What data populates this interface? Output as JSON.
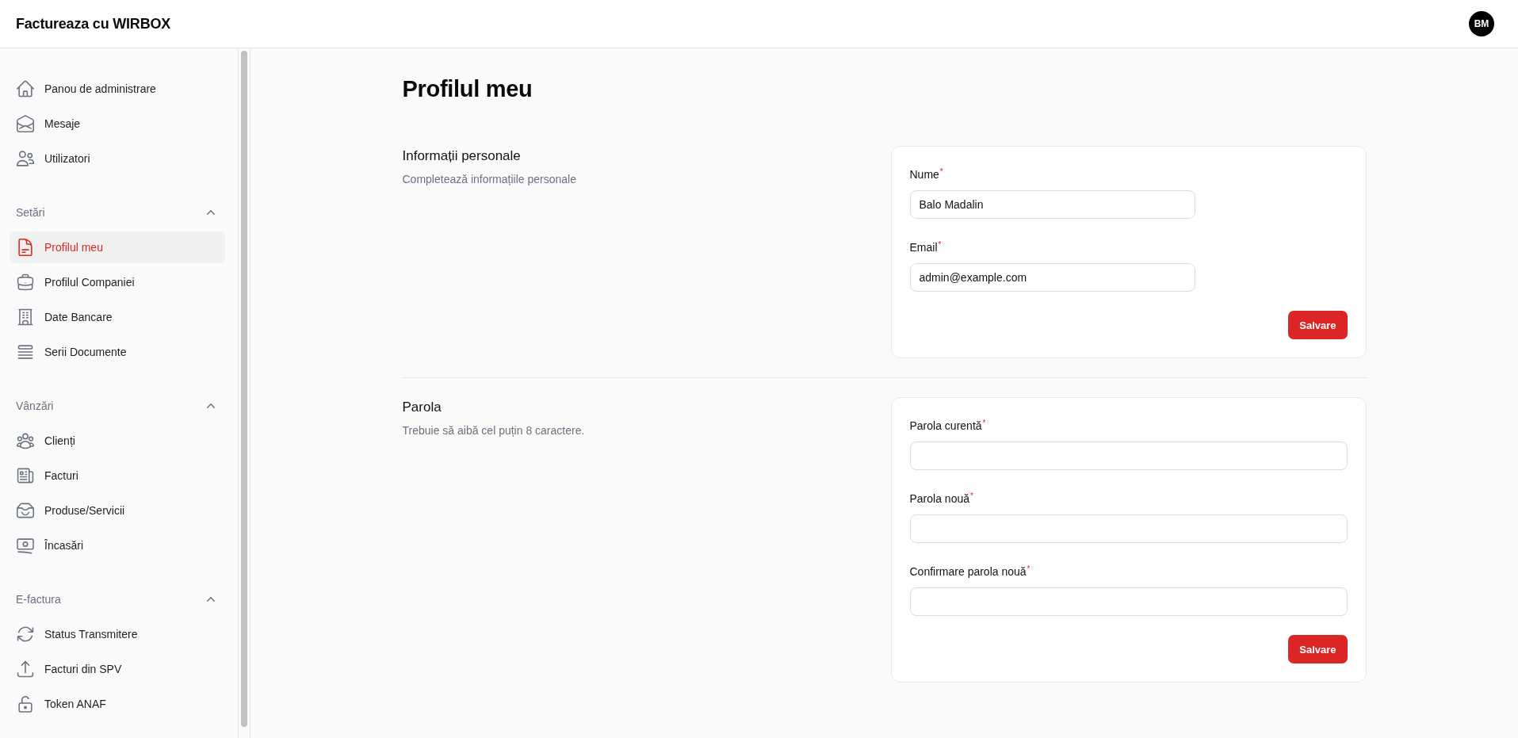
{
  "header": {
    "title": "Factureaza cu WIRBOX",
    "avatar_initials": "BM"
  },
  "sidebar": {
    "groups": [
      {
        "items": [
          {
            "label": "Panou de administrare",
            "selected": false
          },
          {
            "label": "Mesaje",
            "selected": false
          },
          {
            "label": "Utilizatori",
            "selected": false
          }
        ]
      },
      {
        "title": "Setări",
        "expanded": true,
        "items": [
          {
            "label": "Profilul meu",
            "selected": true
          },
          {
            "label": "Profilul Companiei",
            "selected": false
          },
          {
            "label": "Date Bancare",
            "selected": false
          },
          {
            "label": "Serii Documente",
            "selected": false
          }
        ]
      },
      {
        "title": "Vânzări",
        "expanded": true,
        "items": [
          {
            "label": "Clienți",
            "selected": false
          },
          {
            "label": "Facturi",
            "selected": false
          },
          {
            "label": "Produse/Servicii",
            "selected": false
          },
          {
            "label": "Încasări",
            "selected": false
          }
        ]
      },
      {
        "title": "E-factura",
        "expanded": true,
        "items": [
          {
            "label": "Status Transmitere",
            "selected": false
          },
          {
            "label": "Facturi din SPV",
            "selected": false
          },
          {
            "label": "Token ANAF",
            "selected": false
          }
        ]
      }
    ]
  },
  "page": {
    "title": "Profilul meu",
    "sections": [
      {
        "title": "Informații personale",
        "description": "Completează informațiile personale",
        "fields": [
          {
            "kind": "text",
            "label": "Nume$^{*}$",
            "value": "Balo Madalin"
          },
          {
            "kind": "email",
            "label": "Email$^{*}$",
            "value": "admin@example.com"
          }
        ],
        "button": "Salvare"
      },
      {
        "title": "Parola",
        "description": "Trebuie să aibă cel puțin 8 caractere.",
        "fields": [
          {
            "kind": "password",
            "label": "Parola curentă$^{*}$"
          },
          {
            "kind": "password",
            "label": "Parola nouă$^{*}$"
          },
          {
            "kind": "password",
            "label": "Confirmare parola nouă$^{*}$"
          }
        ],
        "button": "Salvare"
      }
    ]
  }
}
